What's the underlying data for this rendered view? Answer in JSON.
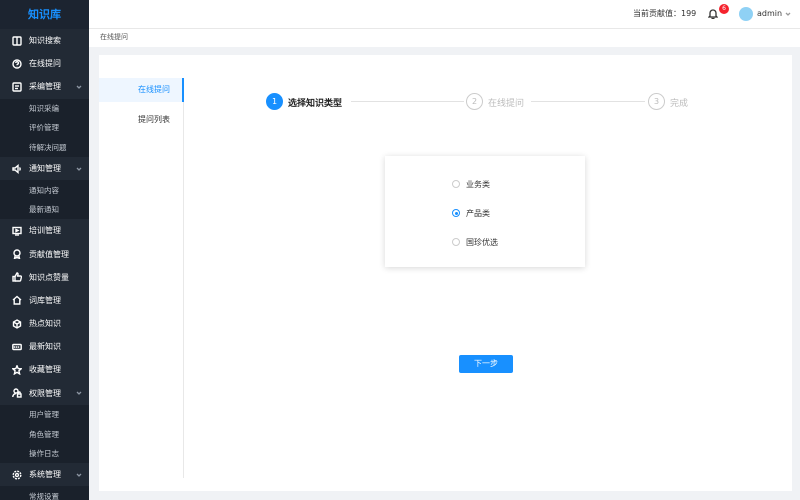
{
  "app": {
    "title": "知识库"
  },
  "sidebar": {
    "items": [
      {
        "label": "知识搜索",
        "icon": "book-icon",
        "type": "item"
      },
      {
        "label": "在线提问",
        "icon": "question-icon",
        "type": "item"
      },
      {
        "label": "采编管理",
        "icon": "edit-doc-icon",
        "type": "group",
        "expanded": true,
        "children": [
          "知识采编",
          "评价管理",
          "待解决问题"
        ]
      },
      {
        "label": "通知管理",
        "icon": "speaker-icon",
        "type": "group",
        "expanded": true,
        "children": [
          "通知内容",
          "最新通知"
        ]
      },
      {
        "label": "培训管理",
        "icon": "training-icon",
        "type": "item"
      },
      {
        "label": "贡献值管理",
        "icon": "award-icon",
        "type": "item"
      },
      {
        "label": "知识点赞量",
        "icon": "thumb-up-icon",
        "type": "item"
      },
      {
        "label": "词库管理",
        "icon": "home-icon",
        "type": "item"
      },
      {
        "label": "热点知识",
        "icon": "hot-icon",
        "type": "item"
      },
      {
        "label": "最新知识",
        "icon": "new-icon",
        "type": "item"
      },
      {
        "label": "收藏管理",
        "icon": "star-icon",
        "type": "item"
      },
      {
        "label": "权限管理",
        "icon": "user-lock-icon",
        "type": "group",
        "expanded": true,
        "children": [
          "用户管理",
          "角色管理",
          "操作日志"
        ]
      },
      {
        "label": "系统管理",
        "icon": "gear-icon",
        "type": "group",
        "expanded": true,
        "children": [
          "常规设置"
        ]
      }
    ]
  },
  "header": {
    "contribution_label": "当前贡献值：",
    "contribution_value": "199",
    "notification_count": "6",
    "username": "admin"
  },
  "breadcrumb": {
    "current": "在线提问"
  },
  "left_nav": {
    "items": [
      {
        "label": "在线提问",
        "active": true
      },
      {
        "label": "提问列表",
        "active": false
      }
    ]
  },
  "steps": [
    {
      "num": "1",
      "label": "选择知识类型",
      "active": true
    },
    {
      "num": "2",
      "label": "在线提问",
      "active": false
    },
    {
      "num": "3",
      "label": "完成",
      "active": false
    }
  ],
  "options": [
    {
      "label": "业务类",
      "checked": false
    },
    {
      "label": "产品类",
      "checked": true
    },
    {
      "label": "国珍优选",
      "checked": false
    }
  ],
  "actions": {
    "next_label": "下一步"
  },
  "colors": {
    "accent": "#1890ff",
    "sidebar_bg": "#222a35",
    "badge": "#f5222d"
  }
}
